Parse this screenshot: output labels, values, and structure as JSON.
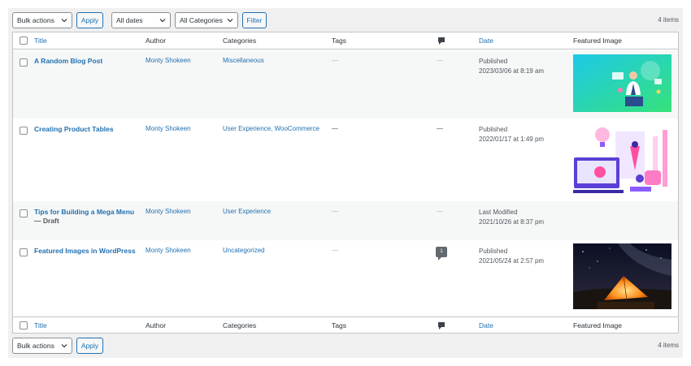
{
  "tablenav_top": {
    "bulk_actions": "Bulk actions",
    "apply": "Apply",
    "dates_filter": "All dates",
    "categories_filter": "All Categories",
    "filter": "Filter",
    "count": "4 items"
  },
  "tablenav_bottom": {
    "bulk_actions": "Bulk actions",
    "apply": "Apply",
    "count": "4 items"
  },
  "columns": {
    "title": "Title",
    "author": "Author",
    "categories": "Categories",
    "tags": "Tags",
    "date": "Date",
    "featured_image": "Featured Image"
  },
  "posts": [
    {
      "title": "A Random Blog Post",
      "author": "Monty Shokeen",
      "categories": "Miscellaneous",
      "tags": "—",
      "comments": "—",
      "date_status": "Published",
      "date_value": "2023/03/06 at 8:19 am",
      "image": "doctor-illustration"
    },
    {
      "title": "Creating Product Tables",
      "author": "Monty Shokeen",
      "categories": "User Experience, WooCommerce",
      "tags": "—",
      "comments": "—",
      "date_status": "Published",
      "date_value": "2022/01/17 at 1:49 pm",
      "image": "design-tools-illustration"
    },
    {
      "title": "Tips for Building a Mega Menu",
      "state": "— Draft",
      "author": "Monty Shokeen",
      "categories": "User Experience",
      "tags": "—",
      "comments": "—",
      "date_status": "Last Modified",
      "date_value": "2021/10/26 at 8:37 pm",
      "image": ""
    },
    {
      "title": "Featured Images in WordPress",
      "author": "Monty Shokeen",
      "categories": "Uncategorized",
      "tags": "—",
      "comments": "1",
      "date_status": "Published",
      "date_value": "2021/05/24 at 2:57 pm",
      "image": "tent-night-photo"
    }
  ],
  "icons": {
    "comments_column": "comment-bubble-icon",
    "dropdown": "chevron-down-icon"
  },
  "colors": {
    "link": "#2271b1",
    "border": "#c3c4c7",
    "background": "#f0f0f1"
  }
}
